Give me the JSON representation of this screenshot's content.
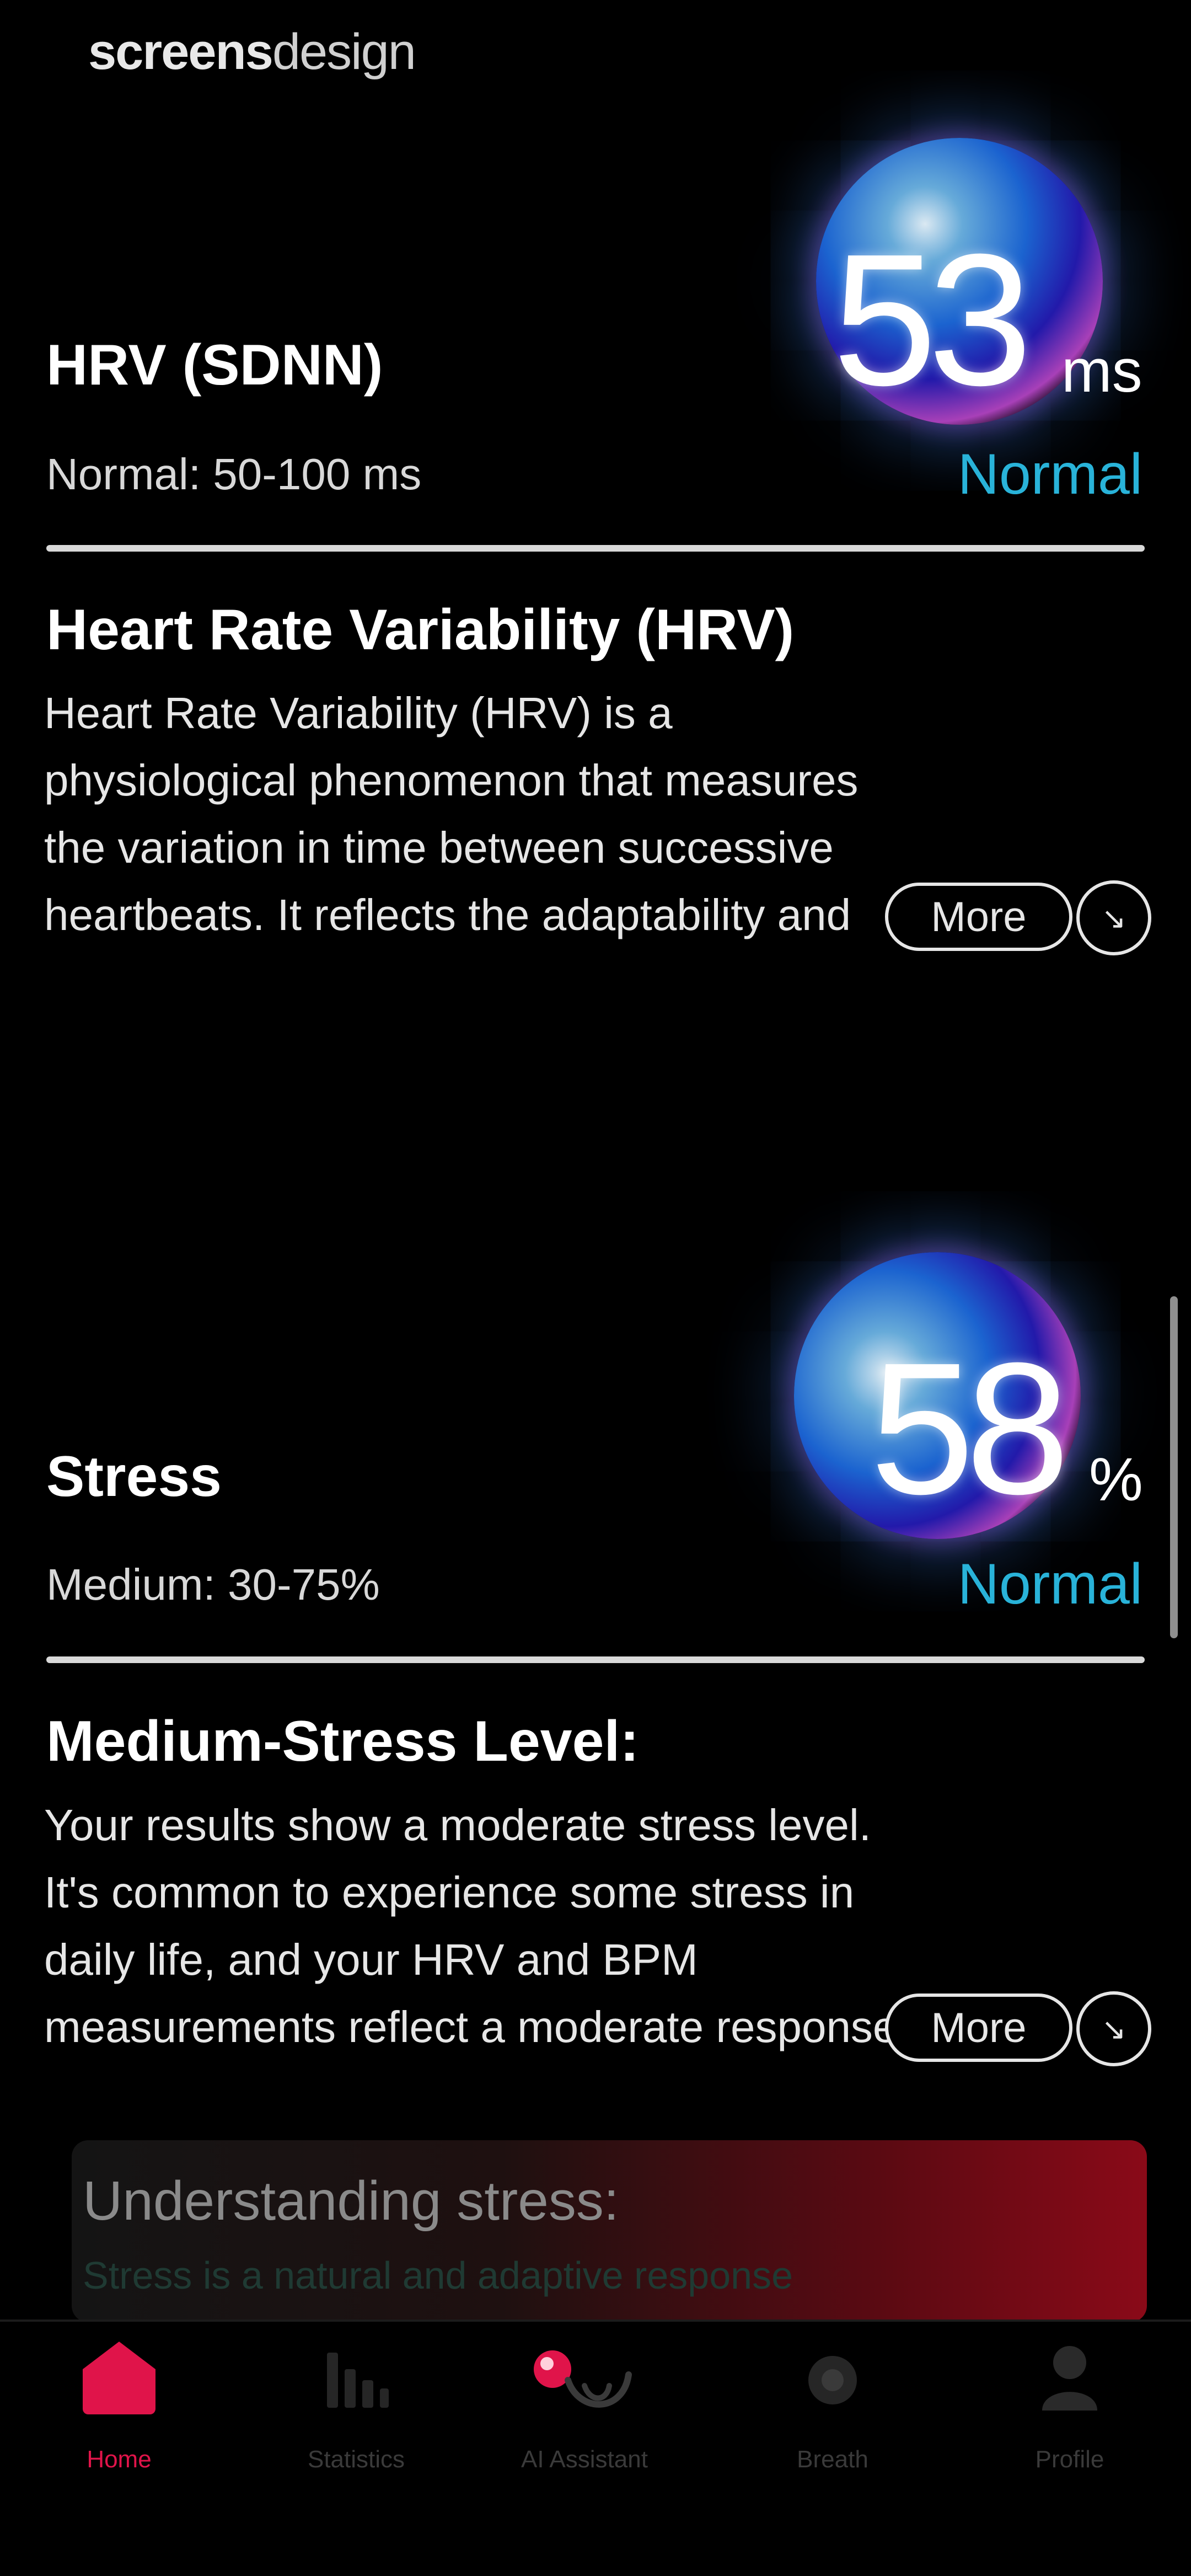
{
  "watermark": {
    "bold": "screens",
    "light": "design"
  },
  "hrv": {
    "value": "53",
    "unit": "ms",
    "name": "HRV (SDNN)",
    "range": "Normal: 50-100 ms",
    "status": "Normal",
    "section_title": "Heart Rate Variability (HRV)",
    "section_body": " Heart Rate Variability (HRV) is a physiological phenomenon that measures the variation in time between successive heartbeats. It reflects the adaptability and flexibility of our autonomic nervous system.",
    "more_label": "More",
    "arrow_icon": "arrow-down-right-icon"
  },
  "stress": {
    "value": "58",
    "unit": "%",
    "name": "Stress",
    "range": "Medium: 30-75%",
    "status": "Normal",
    "section_title": "Medium-Stress Level:",
    "section_body": " Your results show a moderate stress level. It's common to experience some stress in daily life, and your HRV and BPM measurements reflect a moderate response. This could be due to various factors.",
    "more_label": "More",
    "arrow_icon": "arrow-down-right-icon"
  },
  "understanding_card": {
    "title": "Understanding stress:",
    "text": "Stress is a natural and adaptive response"
  },
  "tabs": [
    {
      "label": "Home",
      "icon": "home-icon",
      "active": true
    },
    {
      "label": "Statistics",
      "icon": "bar-chart-icon",
      "active": false
    },
    {
      "label": "AI Assistant",
      "icon": "ai-assistant-icon",
      "active": false
    },
    {
      "label": "Breath",
      "icon": "breath-icon",
      "active": false
    },
    {
      "label": "Profile",
      "icon": "profile-icon",
      "active": false
    }
  ],
  "colors": {
    "background": "#000000",
    "status": "#29b3d9",
    "accent": "#e0144a",
    "divider": "#d9d9d9"
  }
}
